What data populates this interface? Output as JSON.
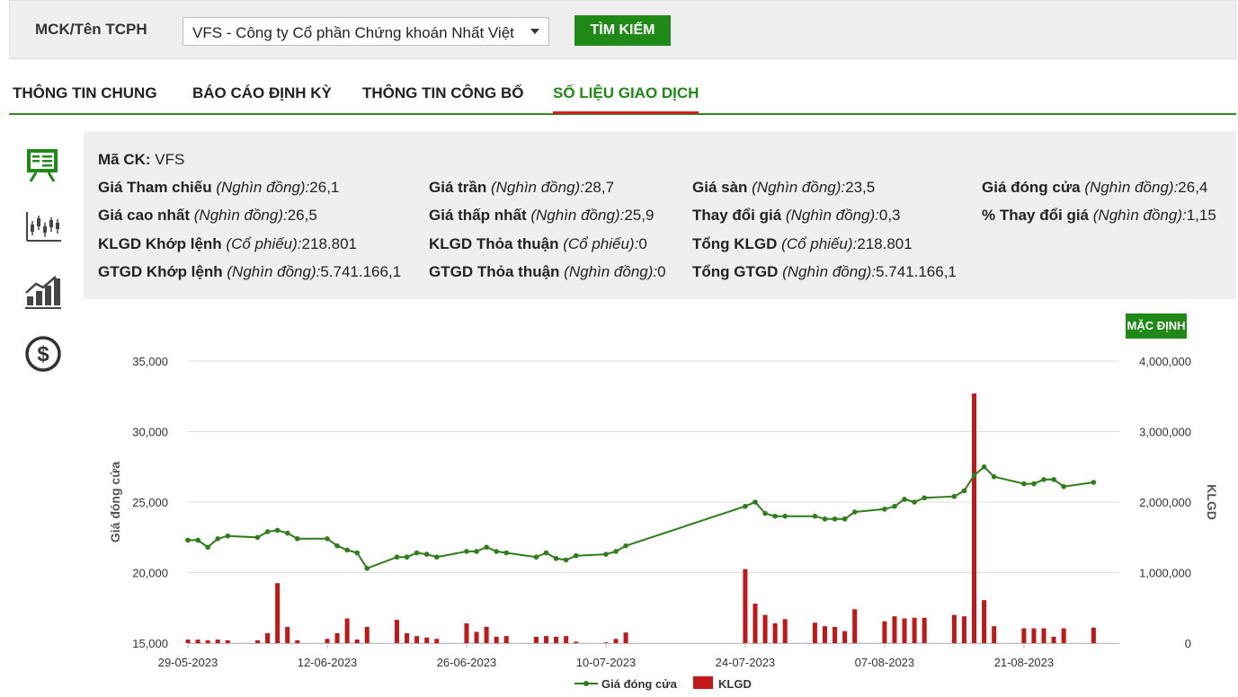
{
  "search": {
    "label": "MCK/Tên TCPH",
    "selected": "VFS - Công ty Cổ phần Chứng khoán Nhất Việt",
    "button_label": "TÌM KIẾM"
  },
  "tabs": [
    {
      "label": "THÔNG TIN CHUNG",
      "active": false
    },
    {
      "label": "BÁO CÁO ĐỊNH KỲ",
      "active": false
    },
    {
      "label": "THÔNG TIN CÔNG BỐ",
      "active": false
    },
    {
      "label": "SỐ LIỆU GIAO DỊCH",
      "active": true
    }
  ],
  "side_icons": [
    "presentation-board-icon",
    "candlestick-chart-icon",
    "growth-chart-icon",
    "dollar-coin-icon"
  ],
  "info": {
    "ma_ck": {
      "label": "Mã CK:",
      "value": "VFS"
    },
    "gia_tham_chieu": {
      "label": "Giá Tham chiếu",
      "unit": "(Nghìn đồng):",
      "value": "26,1"
    },
    "gia_tran": {
      "label": "Giá trần",
      "unit": "(Nghìn đồng):",
      "value": "28,7"
    },
    "gia_san": {
      "label": "Giá sàn",
      "unit": "(Nghìn đồng):",
      "value": "23,5"
    },
    "gia_dong_cua": {
      "label": "Giá đóng cửa",
      "unit": "(Nghìn đồng):",
      "value": "26,4"
    },
    "gia_cao_nhat": {
      "label": "Giá cao nhất",
      "unit": "(Nghìn đồng):",
      "value": "26,5"
    },
    "gia_thap_nhat": {
      "label": "Giá thấp nhất",
      "unit": "(Nghìn đồng):",
      "value": "25,9"
    },
    "thay_doi_gia": {
      "label": "Thay đổi giá",
      "unit": "(Nghìn đồng):",
      "value": "0,3"
    },
    "pct_thay_doi_gia": {
      "label": "% Thay đổi giá",
      "unit": "(Nghìn đồng):",
      "value": "1,15"
    },
    "klgd_khop_lenh": {
      "label": "KLGD Khớp lệnh",
      "unit": "(Cổ phiếu):",
      "value": "218.801"
    },
    "klgd_thoa_thuan": {
      "label": "KLGD Thỏa thuận",
      "unit": "(Cổ phiếu):",
      "value": "0"
    },
    "tong_klgd": {
      "label": "Tổng KLGD",
      "unit": "(Cổ phiếu):",
      "value": "218.801"
    },
    "gtgd_khop_lenh": {
      "label": "GTGD Khớp lệnh",
      "unit": "(Nghìn đồng):",
      "value": "5.741.166,1"
    },
    "gtgd_thoa_thuan": {
      "label": "GTGD Thỏa thuận",
      "unit": "(Nghìn đồng):",
      "value": "0"
    },
    "tong_gtgd": {
      "label": "Tổng GTGD",
      "unit": "(Nghìn đồng):",
      "value": "5.741.166,1"
    }
  },
  "chart_controls": {
    "default_label": "MẶC ĐỊNH"
  },
  "colors": {
    "accent": "#1f8a17",
    "price_line": "#2e7d1a",
    "volume_bar": "#c01818",
    "active_tab_underline": "#d21f1f"
  },
  "chart_data": {
    "type": "line+bar",
    "x_start": "2023-05-29",
    "x_ticks": [
      "29-05-2023",
      "12-06-2023",
      "26-06-2023",
      "10-07-2023",
      "24-07-2023",
      "07-08-2023",
      "21-08-2023"
    ],
    "ylabel_left": "Giá đóng cửa",
    "ylabel_right": "KLGD",
    "ylim_left": [
      15000,
      35000
    ],
    "ylim_right": [
      0,
      4000000
    ],
    "y_ticks_left": [
      "15,000",
      "20,000",
      "25,000",
      "30,000",
      "35,000"
    ],
    "y_ticks_right": [
      "0",
      "1,000,000",
      "2,000,000",
      "3,000,000",
      "4,000,000"
    ],
    "grid": true,
    "legend_position": "bottom",
    "series": [
      {
        "name": "Giá đóng cửa",
        "kind": "line",
        "points": [
          [
            "2023-05-29",
            22300
          ],
          [
            "2023-05-30",
            22300
          ],
          [
            "2023-05-31",
            21800
          ],
          [
            "2023-06-01",
            22400
          ],
          [
            "2023-06-02",
            22600
          ],
          [
            "2023-06-05",
            22500
          ],
          [
            "2023-06-06",
            22900
          ],
          [
            "2023-06-07",
            23000
          ],
          [
            "2023-06-08",
            22800
          ],
          [
            "2023-06-09",
            22400
          ],
          [
            "2023-06-12",
            22400
          ],
          [
            "2023-06-13",
            21900
          ],
          [
            "2023-06-14",
            21600
          ],
          [
            "2023-06-15",
            21400
          ],
          [
            "2023-06-16",
            20300
          ],
          [
            "2023-06-19",
            21100
          ],
          [
            "2023-06-20",
            21100
          ],
          [
            "2023-06-21",
            21400
          ],
          [
            "2023-06-22",
            21300
          ],
          [
            "2023-06-23",
            21100
          ],
          [
            "2023-06-26",
            21500
          ],
          [
            "2023-06-27",
            21500
          ],
          [
            "2023-06-28",
            21800
          ],
          [
            "2023-06-29",
            21500
          ],
          [
            "2023-06-30",
            21400
          ],
          [
            "2023-07-03",
            21100
          ],
          [
            "2023-07-04",
            21400
          ],
          [
            "2023-07-05",
            21000
          ],
          [
            "2023-07-06",
            20900
          ],
          [
            "2023-07-07",
            21200
          ],
          [
            "2023-07-10",
            21300
          ],
          [
            "2023-07-11",
            21500
          ],
          [
            "2023-07-12",
            21900
          ],
          [
            "2023-07-24",
            24700
          ],
          [
            "2023-07-25",
            25000
          ],
          [
            "2023-07-26",
            24200
          ],
          [
            "2023-07-27",
            24000
          ],
          [
            "2023-07-28",
            24000
          ],
          [
            "2023-07-31",
            24000
          ],
          [
            "2023-08-01",
            23800
          ],
          [
            "2023-08-02",
            23800
          ],
          [
            "2023-08-03",
            23800
          ],
          [
            "2023-08-04",
            24300
          ],
          [
            "2023-08-07",
            24500
          ],
          [
            "2023-08-08",
            24700
          ],
          [
            "2023-08-09",
            25200
          ],
          [
            "2023-08-10",
            25000
          ],
          [
            "2023-08-11",
            25300
          ],
          [
            "2023-08-14",
            25400
          ],
          [
            "2023-08-15",
            25800
          ],
          [
            "2023-08-16",
            26900
          ],
          [
            "2023-08-17",
            27500
          ],
          [
            "2023-08-18",
            26800
          ],
          [
            "2023-08-21",
            26300
          ],
          [
            "2023-08-22",
            26300
          ],
          [
            "2023-08-23",
            26600
          ],
          [
            "2023-08-24",
            26600
          ],
          [
            "2023-08-25",
            26100
          ],
          [
            "2023-08-28",
            26400
          ]
        ]
      },
      {
        "name": "KLGD",
        "kind": "bar",
        "points": [
          [
            "2023-05-29",
            50000
          ],
          [
            "2023-05-30",
            50000
          ],
          [
            "2023-05-31",
            40000
          ],
          [
            "2023-06-01",
            50000
          ],
          [
            "2023-06-02",
            40000
          ],
          [
            "2023-06-05",
            40000
          ],
          [
            "2023-06-06",
            140000
          ],
          [
            "2023-06-07",
            850000
          ],
          [
            "2023-06-08",
            230000
          ],
          [
            "2023-06-09",
            40000
          ],
          [
            "2023-06-12",
            60000
          ],
          [
            "2023-06-13",
            140000
          ],
          [
            "2023-06-14",
            350000
          ],
          [
            "2023-06-15",
            50000
          ],
          [
            "2023-06-16",
            230000
          ],
          [
            "2023-06-19",
            330000
          ],
          [
            "2023-06-20",
            140000
          ],
          [
            "2023-06-21",
            100000
          ],
          [
            "2023-06-22",
            80000
          ],
          [
            "2023-06-23",
            60000
          ],
          [
            "2023-06-26",
            280000
          ],
          [
            "2023-06-27",
            160000
          ],
          [
            "2023-06-28",
            230000
          ],
          [
            "2023-06-29",
            90000
          ],
          [
            "2023-06-30",
            100000
          ],
          [
            "2023-07-03",
            90000
          ],
          [
            "2023-07-04",
            100000
          ],
          [
            "2023-07-05",
            90000
          ],
          [
            "2023-07-06",
            100000
          ],
          [
            "2023-07-07",
            20000
          ],
          [
            "2023-07-10",
            10000
          ],
          [
            "2023-07-11",
            60000
          ],
          [
            "2023-07-12",
            150000
          ],
          [
            "2023-07-24",
            1050000
          ],
          [
            "2023-07-25",
            560000
          ],
          [
            "2023-07-26",
            400000
          ],
          [
            "2023-07-27",
            280000
          ],
          [
            "2023-07-28",
            340000
          ],
          [
            "2023-07-31",
            290000
          ],
          [
            "2023-08-01",
            240000
          ],
          [
            "2023-08-02",
            230000
          ],
          [
            "2023-08-03",
            170000
          ],
          [
            "2023-08-04",
            480000
          ],
          [
            "2023-08-07",
            310000
          ],
          [
            "2023-08-08",
            380000
          ],
          [
            "2023-08-09",
            350000
          ],
          [
            "2023-08-10",
            360000
          ],
          [
            "2023-08-11",
            360000
          ],
          [
            "2023-08-14",
            400000
          ],
          [
            "2023-08-15",
            380000
          ],
          [
            "2023-08-16",
            3540000
          ],
          [
            "2023-08-17",
            610000
          ],
          [
            "2023-08-18",
            240000
          ],
          [
            "2023-08-21",
            210000
          ],
          [
            "2023-08-22",
            210000
          ],
          [
            "2023-08-23",
            210000
          ],
          [
            "2023-08-24",
            90000
          ],
          [
            "2023-08-25",
            210000
          ],
          [
            "2023-08-28",
            220000
          ]
        ]
      }
    ]
  }
}
